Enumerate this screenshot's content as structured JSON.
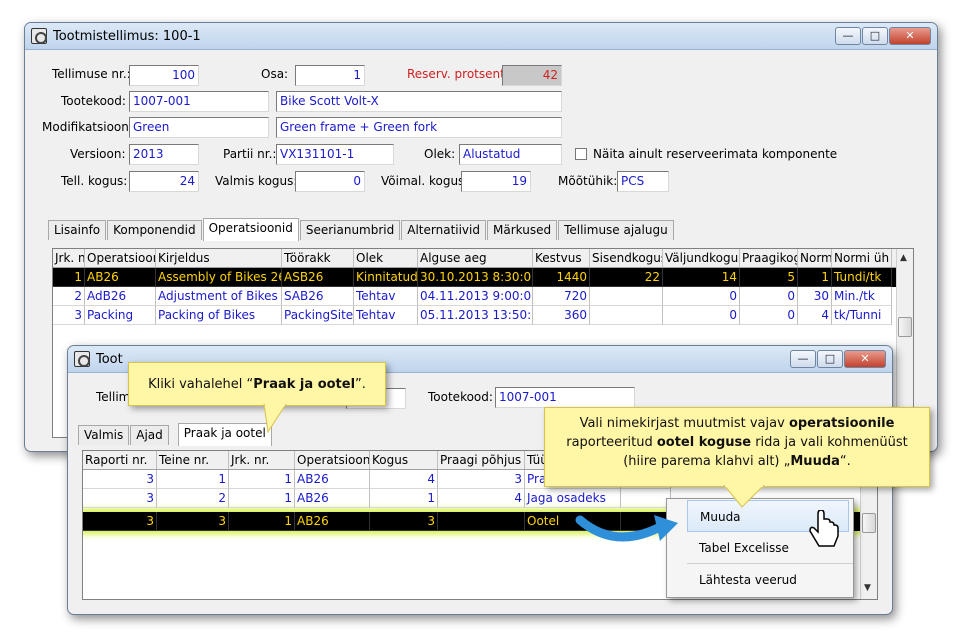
{
  "main": {
    "title": "Tootmistellimus: 100-1",
    "labels": {
      "order_no": "Tellimuse nr.:",
      "part": "Osa:",
      "reserve": "Reserv. protsent:",
      "product_code": "Tootekood:",
      "modification": "Modifikatsioon:",
      "version": "Versioon:",
      "batch": "Partii nr.:",
      "status": "Olek:",
      "show_unreserved": "Näita ainult reserveerimata komponente",
      "ordered_qty": "Tell. kogus:",
      "done_qty": "Valmis kogus:",
      "possible_qty": "Võimal. kogus:",
      "unit": "Mõõtühik:"
    },
    "values": {
      "order_no": "100",
      "part": "1",
      "reserve": "42",
      "product_code": "1007-001",
      "product_name": "Bike Scott Volt-X",
      "modification": "Green",
      "modification_desc": "Green frame + Green fork",
      "version": "2013",
      "batch": "VX131101-1",
      "status": "Alustatud",
      "ordered_qty": "24",
      "done_qty": "0",
      "possible_qty": "19",
      "unit": "PCS"
    },
    "tabs": [
      "Lisainfo",
      "Komponendid",
      "Operatsioonid",
      "Seerianumbrid",
      "Alternatiivid",
      "Märkused",
      "Tellimuse ajalugu"
    ],
    "active_tab": "Operatsioonid",
    "grid": {
      "columns": [
        "Jrk. n",
        "Operatsiooni",
        "Kirjeldus",
        "Töörakk",
        "Olek",
        "Alguse aeg",
        "Kestvus",
        "Sisendkogus",
        "Väljundkogus",
        "Praagikog",
        "Norm",
        "Normi üh"
      ],
      "rows": [
        [
          "1",
          "AB26",
          "Assembly of Bikes 26 in",
          "ASB26",
          "Kinnitatud",
          "30.10.2013 8:30:00",
          "1440",
          "22",
          "14",
          "5",
          "1",
          "Tundi/tk"
        ],
        [
          "2",
          "AdB26",
          "Adjustment of Bikes 26",
          "SAB26",
          "Tehtav",
          "04.11.2013 9:00:00",
          "720",
          "",
          "0",
          "0",
          "30",
          "Min./tk"
        ],
        [
          "3",
          "Packing",
          "Packing of Bikes",
          "PackingSite",
          "Tehtav",
          "05.11.2013 13:50:00",
          "360",
          "",
          "0",
          "0",
          "4",
          "tk/Tunni"
        ]
      ]
    }
  },
  "sub": {
    "title": "Toot",
    "label_order": "Tellim",
    "label_product": "Tootekood:",
    "product_code": "1007-001",
    "tabs": [
      "Valmis",
      "Ajad",
      "Praak ja ootel"
    ],
    "active_tab": "Praak ja ootel",
    "grid": {
      "columns": [
        "Raporti nr.",
        "Teine nr.",
        "Jrk. nr.",
        "Operatsiooni I",
        "Kogus",
        "Praagi põhjus",
        "Tüü"
      ],
      "rows": [
        [
          "3",
          "1",
          "1",
          "AB26",
          "4",
          "3",
          "Pra"
        ],
        [
          "3",
          "2",
          "1",
          "AB26",
          "1",
          "4",
          "Jaga osadeks"
        ],
        [
          "3",
          "3",
          "1",
          "AB26",
          "3",
          "",
          "Ootel"
        ]
      ]
    }
  },
  "context_menu": [
    "Muuda",
    "Tabel Excelisse",
    "Lähtesta veerud"
  ],
  "callout1": {
    "pre": "Kliki vahalehel “",
    "bold": "Praak ja ootel",
    "post": "”."
  },
  "callout2": {
    "t1": "Vali nimekirjast muutmist vajav ",
    "b1": "operatsioonile",
    "t2": " raporteeritud ",
    "b2": "ootel koguse",
    "t3": " rida ja vali kohmenüüst (hiire parema klahvi alt) „",
    "b3": "Muuda",
    "t4": "“."
  },
  "colors": {
    "highlight": "#000000",
    "highlight_text": "#ffd400",
    "value_text": "#1a1acc",
    "callout_bg": "#fff6a6"
  }
}
